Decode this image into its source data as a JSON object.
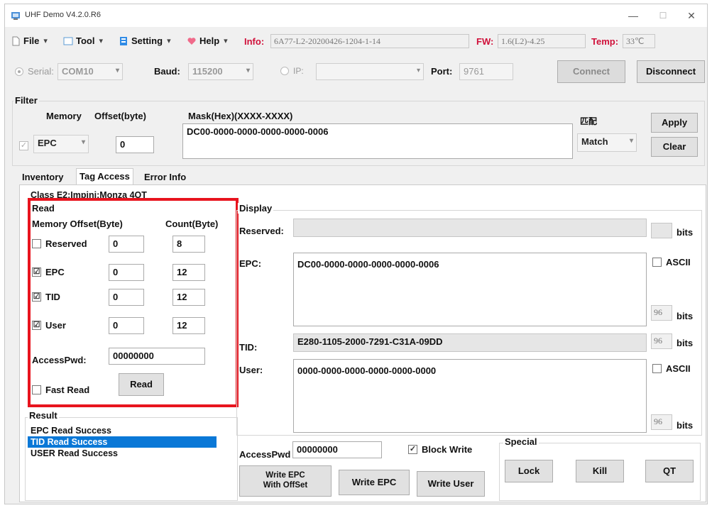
{
  "window": {
    "title": "UHF Demo V4.2.0.R6",
    "minimize": "—",
    "maximize": "☐",
    "close": "✕"
  },
  "menu": {
    "file": "File",
    "tool": "Tool",
    "setting": "Setting",
    "help": "Help",
    "caret": "▾",
    "info_label": "Info:",
    "info_value": "6A77-L2-20200426-1204-1-14",
    "fw_label": "FW:",
    "fw_value": "1.6(L2)-4.25",
    "temp_label": "Temp:",
    "temp_value": "33℃"
  },
  "connection": {
    "serial_label": "Serial:",
    "serial_value": "COM10",
    "baud_label": "Baud:",
    "baud_value": "115200",
    "ip_label": "IP:",
    "ip_value": "",
    "port_label": "Port:",
    "port_value": "9761",
    "connect": "Connect",
    "disconnect": "Disconnect"
  },
  "filter": {
    "title": "Filter",
    "memory_label": "Memory",
    "offset_label": "Offset(byte)",
    "mask_label": "Mask(Hex)(XXXX-XXXX)",
    "match_title": "匹配",
    "memory_value": "EPC",
    "offset_value": "0",
    "mask_value": "DC00-0000-0000-0000-0000-0006",
    "match_value": "Match",
    "apply": "Apply",
    "clear": "Clear"
  },
  "tabs": [
    "Inventory",
    "Tag Access",
    "Error Info"
  ],
  "tag_class": "Class E2:Impinj:Monza 4QT",
  "read": {
    "title": "Read",
    "col_memory": "Memory Offset(Byte)",
    "col_count": "Count(Byte)",
    "rows": [
      {
        "label": "Reserved",
        "checked": "",
        "offset": "0",
        "count": "8"
      },
      {
        "label": "EPC",
        "checked": "☑",
        "offset": "0",
        "count": "12"
      },
      {
        "label": "TID",
        "checked": "☑",
        "offset": "0",
        "count": "12"
      },
      {
        "label": "User",
        "checked": "☑",
        "offset": "0",
        "count": "12"
      }
    ],
    "accesspwd_label": "AccessPwd:",
    "accesspwd_value": "00000000",
    "fast_read": "Fast Read",
    "read_button": "Read"
  },
  "result": {
    "title": "Result",
    "items": [
      "EPC Read Success",
      "TID Read Success",
      "USER Read Success"
    ]
  },
  "display": {
    "title": "Display",
    "reserved_label": "Reserved:",
    "reserved_value": "",
    "epc_label": "EPC:",
    "epc_value": "DC00-0000-0000-0000-0000-0006",
    "epc_bits": "96",
    "tid_label": "TID:",
    "tid_value": "E280-1105-2000-7291-C31A-09DD",
    "tid_bits": "96",
    "user_label": "User:",
    "user_value": "0000-0000-0000-0000-0000-0000",
    "user_bits": "96",
    "bits_unit": "bits",
    "ascii": "ASCII"
  },
  "write": {
    "accesspwd_label": "AccessPwd",
    "accesspwd_value": "00000000",
    "block_write": "Block Write",
    "write_epc_offset_line1": "Write EPC",
    "write_epc_offset_line2": "With OffSet",
    "write_epc": "Write EPC",
    "write_user": "Write User"
  },
  "special": {
    "title": "Special",
    "lock": "Lock",
    "kill": "Kill",
    "qt": "QT"
  }
}
